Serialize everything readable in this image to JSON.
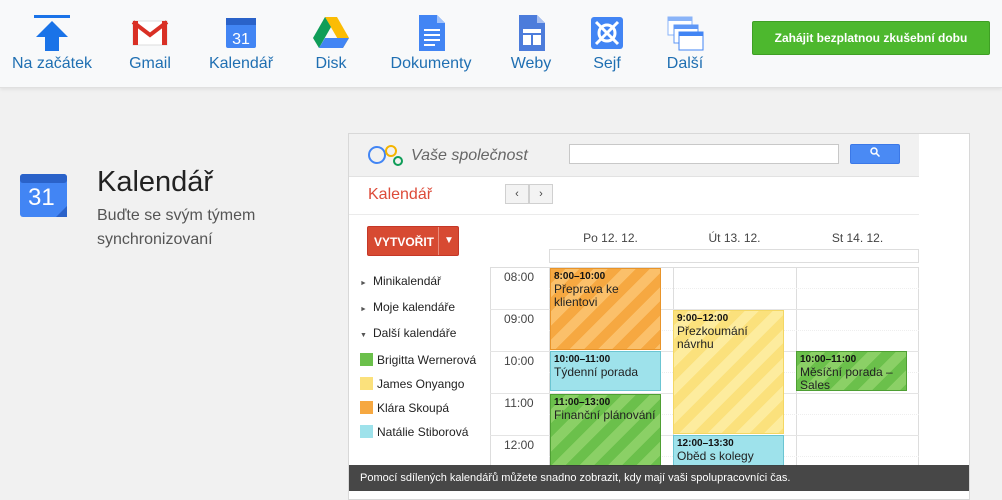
{
  "nav": {
    "items": [
      {
        "label": "Na začátek",
        "icon": "up-arrow-icon"
      },
      {
        "label": "Gmail",
        "icon": "gmail-icon"
      },
      {
        "label": "Kalendář",
        "icon": "calendar-icon"
      },
      {
        "label": "Disk",
        "icon": "drive-icon"
      },
      {
        "label": "Dokumenty",
        "icon": "docs-icon"
      },
      {
        "label": "Weby",
        "icon": "sites-icon"
      },
      {
        "label": "Sejf",
        "icon": "vault-icon"
      },
      {
        "label": "Další",
        "icon": "more-apps-icon"
      }
    ],
    "trial_button": "Zahájit bezplatnou zkušební dobu"
  },
  "product": {
    "icon_text": "31",
    "title": "Kalendář",
    "description": "Buďte se svým týmem synchronizovaní"
  },
  "mock": {
    "company": "Vaše společnost",
    "app_title": "Kalendář",
    "prev_label": "‹",
    "next_label": "›",
    "create_label": "VYTVOŘIT",
    "create_arrow": "▼",
    "days": [
      "Po 12. 12.",
      "Út 13. 12.",
      "St 14. 12."
    ],
    "sidebar": [
      "Minikalendář",
      "Moje kalendáře",
      "Další kalendáře"
    ],
    "people": [
      {
        "name": "Brigitta Wernerová",
        "color": "#6bc04b"
      },
      {
        "name": "James Onyango",
        "color": "#fbe17c"
      },
      {
        "name": "Klára Skoupá",
        "color": "#f6a841"
      },
      {
        "name": "Natálie Stiborová",
        "color": "#9ee2eb"
      }
    ],
    "hours": [
      "08:00",
      "09:00",
      "10:00",
      "11:00",
      "12:00"
    ],
    "events": [
      {
        "time": "8:00–10:00",
        "title": "Přeprava ke klientovi"
      },
      {
        "time": "10:00–11:00",
        "title": "Týdenní porada"
      },
      {
        "time": "11:00–13:00",
        "title": "Finanční plánování"
      },
      {
        "time": "9:00–12:00",
        "title": "Přezkoumání návrhu"
      },
      {
        "time": "12:00–13:30",
        "title": "Oběd s kolegy"
      },
      {
        "time": "10:00–11:00",
        "title": "Měsíční porada – Sales"
      }
    ],
    "caption": "Pomocí sdílených kalendářů můžete snadno zobrazit, kdy mají vaši spolupracovníci čas."
  },
  "colors": {
    "accent": "#1f6fb2",
    "trial_green": "#4db82e",
    "create_red": "#d74a32",
    "app_title_red": "#dd4b39"
  }
}
